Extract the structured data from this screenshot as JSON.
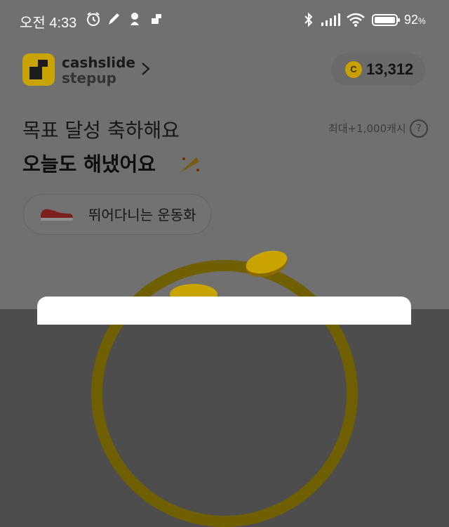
{
  "status_bar": {
    "time": "오전 4:33",
    "battery_percent": "92",
    "battery_unit": "%",
    "icons": [
      "alarm-icon",
      "pen-icon",
      "tree-icon",
      "app-icon",
      "bluetooth-icon",
      "signal-icon",
      "wifi-icon",
      "battery-icon"
    ]
  },
  "header": {
    "logo_name": "cashslide",
    "logo_sub": "stepup",
    "coin_symbol": "C",
    "coin_balance": "13,312"
  },
  "goal": {
    "line1": "목표 달성 축하해요",
    "line2": "오늘도 해냈어요",
    "max_reward": "최대+1,000캐시",
    "help_symbol": "?"
  },
  "item_chip": {
    "label": "뛰어다니는 운동화"
  },
  "colors": {
    "accent": "#c9a300",
    "overlay": "#707070"
  }
}
